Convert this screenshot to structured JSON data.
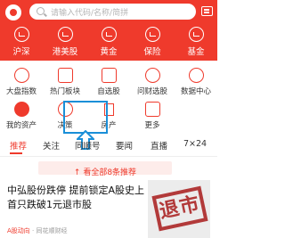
{
  "colors": {
    "brand": "#ef3a2c",
    "highlight": "#1a8fd8"
  },
  "search": {
    "placeholder": "请输入代码/名称/简拼"
  },
  "topnav": [
    {
      "label": "沪深",
      "icon": "shanghai-shenzhen-icon"
    },
    {
      "label": "港美股",
      "icon": "hk-us-stocks-icon"
    },
    {
      "label": "黄金",
      "icon": "gold-icon"
    },
    {
      "label": "保险",
      "icon": "insurance-icon"
    },
    {
      "label": "基金",
      "icon": "fund-icon"
    }
  ],
  "grid": [
    {
      "label": "大盘指数",
      "icon": "market-index-icon"
    },
    {
      "label": "热门板块",
      "icon": "hot-sectors-icon"
    },
    {
      "label": "自选股",
      "icon": "watchlist-icon"
    },
    {
      "label": "问财选股",
      "icon": "stock-screener-icon"
    },
    {
      "label": "数据中心",
      "icon": "data-center-icon"
    },
    {
      "label": "我的资产",
      "icon": "my-assets-icon"
    },
    {
      "label": "决策",
      "icon": "decision-icon"
    },
    {
      "label": "房产",
      "icon": "real-estate-icon"
    },
    {
      "label": "更多",
      "icon": "more-icon"
    }
  ],
  "tabs": [
    "推荐",
    "关注",
    "同顺号",
    "要闻",
    "直播",
    "7×24"
  ],
  "banner": {
    "text": "↑ 看全部8条推荐"
  },
  "news": {
    "title": "中弘股份跌停 提前锁定A股史上首只跌破1元退市股",
    "tag": "A股动向",
    "source": "· 同花顺财经",
    "image_text": "退市"
  }
}
